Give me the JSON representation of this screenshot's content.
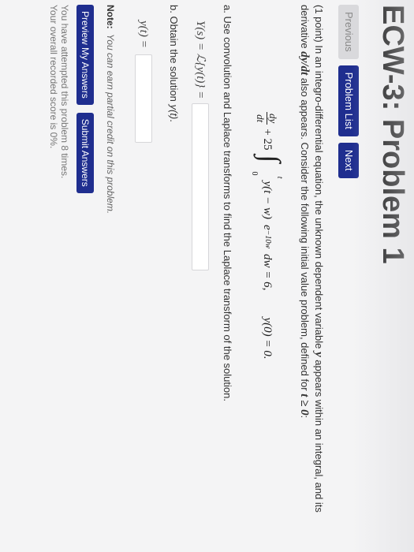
{
  "page": {
    "title": "ECW-3: Problem 1"
  },
  "nav": {
    "previous": "Previous",
    "problem_list": "Problem List",
    "next": "Next"
  },
  "problem": {
    "points": "(1 point)",
    "intro_a": "In an integro-differential equation, the unknown dependent variable",
    "var_y": "y",
    "intro_b": "appears within an integral, and its derivative",
    "var_deriv": "dy/dt",
    "intro_c": "also appears. Consider the following initial value problem, defined for",
    "var_cond": "t ≥ 0",
    "intro_d": ":",
    "equation": {
      "dy": "dy",
      "dt": "dt",
      "plus_25": "+ 25",
      "upper_limit": "t",
      "lower_limit": "0",
      "integrand": "y(t − w)",
      "e": "e",
      "exponent": "−10w",
      "dw_eq": "dw = 6,",
      "initial": "y(0) = 0."
    },
    "part_a": {
      "text": "a. Use convolution and Laplace transforms to find the Laplace transform of the solution.",
      "label": "Y(s) = ℒ{y(t)} =",
      "value": ""
    },
    "part_b": {
      "text_a": "b. Obtain the solution",
      "var": "y(t)",
      "text_b": ".",
      "label": "y(t) =",
      "value": ""
    }
  },
  "note": {
    "label": "Note:",
    "text": "You can earn partial credit on this problem."
  },
  "actions": {
    "preview": "Preview My Answers",
    "submit": "Submit Answers"
  },
  "status": {
    "attempts": "You have attempted this problem 8 times.",
    "score": "Your overall recorded score is 0%."
  },
  "colors": {
    "primary_button": "#1f2e8f",
    "disabled_button": "#d9d9dc",
    "page_background": "#f4f4f5"
  }
}
